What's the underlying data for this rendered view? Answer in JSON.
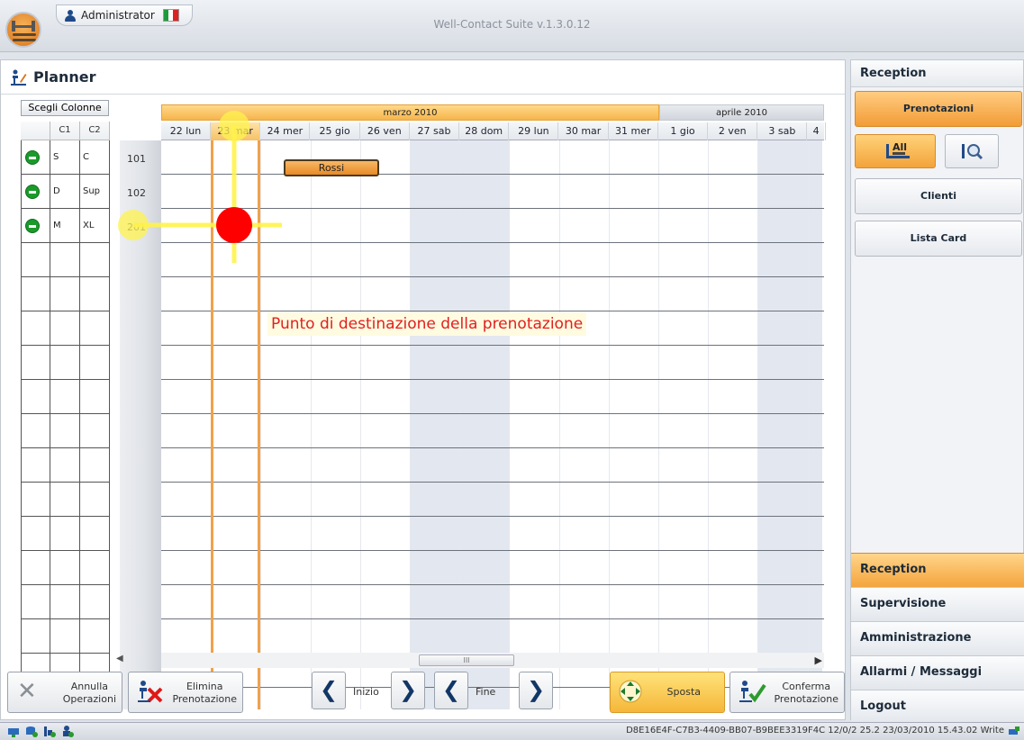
{
  "window": {
    "title": "Well-Contact Suite v.1.3.0.12",
    "user": "Administrator"
  },
  "planner": {
    "title": "Planner",
    "choose_columns": "Scegli Colonne",
    "col_headers": [
      "C1",
      "C2"
    ],
    "months": [
      {
        "label": "marzo 2010"
      },
      {
        "label": "aprile 2010"
      }
    ],
    "days": [
      "22 lun",
      "23 mar",
      "24 mer",
      "25 gio",
      "26 ven",
      "27 sab",
      "28 dom",
      "29 lun",
      "30 mar",
      "31 mer",
      "1 gio",
      "2 ven",
      "3 sab",
      "4"
    ],
    "rows": [
      {
        "c1": "S",
        "c2": "C",
        "room": "101"
      },
      {
        "c1": "D",
        "c2": "Sup",
        "room": "102"
      },
      {
        "c1": "M",
        "c2": "XL",
        "room": "201"
      }
    ],
    "booking": {
      "label": "Rossi"
    },
    "annotation": "Punto di destinazione della prenotazione",
    "scroll_thumb": "III"
  },
  "buttons": {
    "cancel_ops": [
      "Annulla",
      "Operazioni"
    ],
    "delete_booking": [
      "Elimina",
      "Prenotazione"
    ],
    "start": "Inizio",
    "end": "Fine",
    "move": "Sposta",
    "confirm": [
      "Conferma",
      "Prenotazione"
    ]
  },
  "sidebar": {
    "header": "Reception",
    "prenotazioni": "Prenotazioni",
    "all_label": "All",
    "clienti": "Clienti",
    "lista_card": "Lista Card",
    "sections": [
      "Reception",
      "Supervisione",
      "Amministrazione",
      "Allarmi / Messaggi",
      "Logout"
    ]
  },
  "statusbar": {
    "text": "D8E16E4F-C7B3-4409-BB07-B9BEE3319F4C 12/0/2 25.2 23/03/2010 15.43.02 Write"
  },
  "colors": {
    "accent": "#f0a14a",
    "booking": "#e88a24",
    "annotation_red": "#e02020",
    "marker_yellow": "#fff34d"
  }
}
